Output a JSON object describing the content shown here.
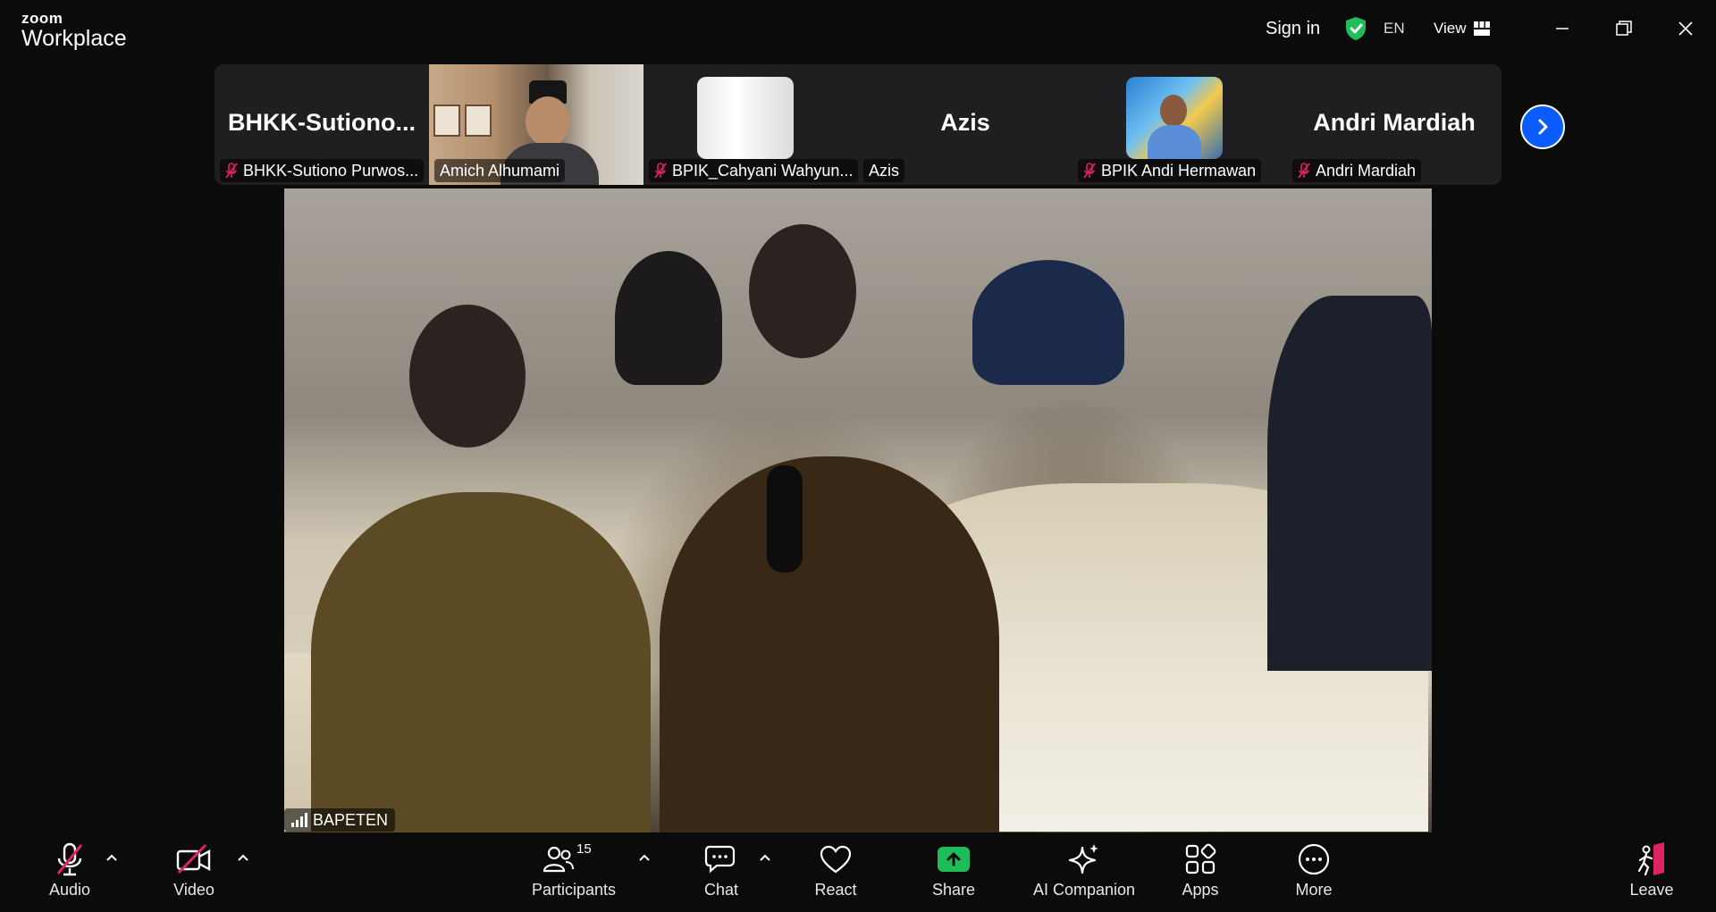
{
  "app": {
    "logo_small": "zoom",
    "logo_big": "Workplace"
  },
  "titlebar": {
    "sign_in": "Sign in",
    "language": "EN",
    "view_label": "View",
    "security_color": "#1fbd59"
  },
  "strip": {
    "tiles": [
      {
        "big_name": "BHKK-Sutiono...",
        "label": "BHKK-Sutiono Purwos...",
        "muted": true,
        "kind": "name-only"
      },
      {
        "big_name": "",
        "label": "Amich Alhumami",
        "muted": false,
        "kind": "video"
      },
      {
        "big_name": "",
        "label": "BPIK_Cahyani Wahyun...",
        "muted": true,
        "kind": "avatar-white"
      },
      {
        "big_name": "Azis",
        "label": "Azis",
        "muted": false,
        "kind": "name-only"
      },
      {
        "big_name": "",
        "label": "BPIK Andi Hermawan",
        "muted": true,
        "kind": "avatar-photo"
      },
      {
        "big_name": "Andri Mardiah",
        "label": "Andri Mardiah",
        "muted": true,
        "kind": "name-only"
      }
    ],
    "next_icon": "chevron-right-icon"
  },
  "main_video": {
    "label": "BAPETEN",
    "signal_icon": "signal-strength-icon"
  },
  "toolbar": {
    "audio": "Audio",
    "video": "Video",
    "participants": "Participants",
    "participant_count": "15",
    "chat": "Chat",
    "react": "React",
    "share": "Share",
    "ai_companion": "AI Companion",
    "apps": "Apps",
    "more": "More",
    "leave": "Leave",
    "muted_color": "#e0245e",
    "share_color": "#1fbd59",
    "leave_color": "#e0245e"
  }
}
